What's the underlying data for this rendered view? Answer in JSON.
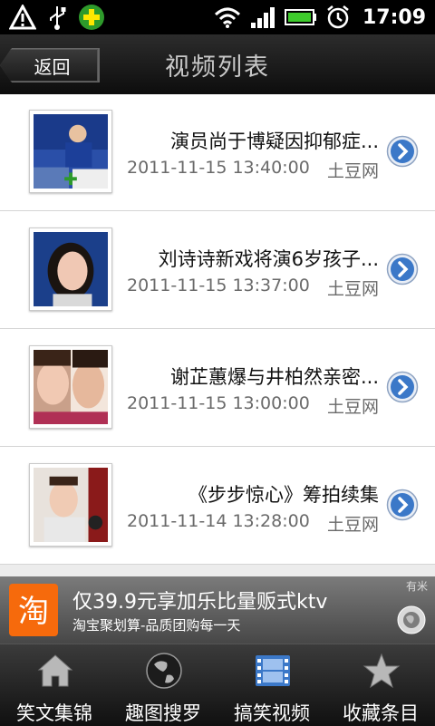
{
  "status_bar": {
    "time": "17:09",
    "icons": [
      "warning-icon",
      "usb-icon",
      "plus-badge-icon",
      "wifi-icon",
      "signal-icon",
      "battery-icon",
      "alarm-icon"
    ]
  },
  "header": {
    "back_label": "返回",
    "title": "视频列表"
  },
  "videos": [
    {
      "title": "演员尚于博疑因抑郁症...",
      "time": "2011-11-15 13:40:00",
      "source": "土豆网"
    },
    {
      "title": "刘诗诗新戏将演6岁孩子...",
      "time": "2011-11-15 13:37:00",
      "source": "土豆网"
    },
    {
      "title": "谢芷蕙爆与井柏然亲密...",
      "time": "2011-11-15 13:00:00",
      "source": "土豆网"
    },
    {
      "title": "《步步惊心》筹拍续集",
      "time": "2011-11-14 13:28:00",
      "source": "土豆网"
    }
  ],
  "ad": {
    "logo_text": "淘",
    "title": "仅39.9元享加乐比量贩式ktv",
    "subtitle": "淘宝聚划算-品质团购每一天",
    "brand": "有米"
  },
  "tabs": [
    {
      "label": "笑文集锦",
      "icon": "home-icon"
    },
    {
      "label": "趣图搜罗",
      "icon": "globe-icon"
    },
    {
      "label": "搞笑视频",
      "icon": "film-icon"
    },
    {
      "label": "收藏条目",
      "icon": "star-icon"
    }
  ],
  "colors": {
    "accent_blue": "#3b78c8",
    "ad_logo": "#f66a0c"
  }
}
